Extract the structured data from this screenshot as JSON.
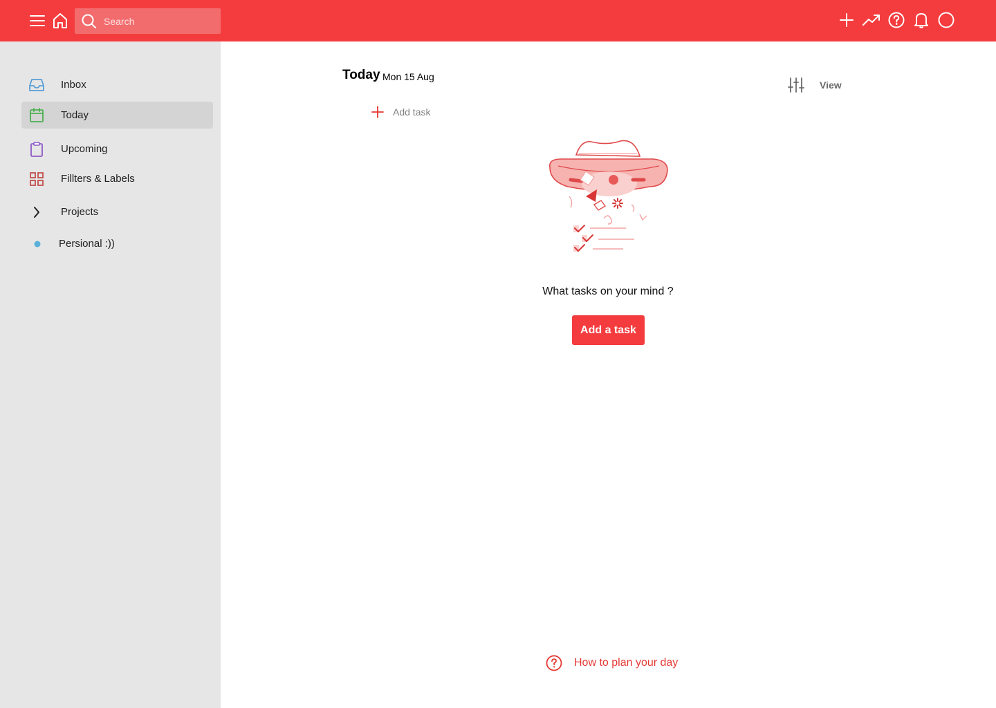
{
  "topbar": {
    "search_placeholder": "Search",
    "colors": {
      "brand": "#f43c3e"
    }
  },
  "sidebar": {
    "items": [
      {
        "label": "Inbox",
        "icon": "inbox-icon",
        "color": "#5a9ed6"
      },
      {
        "label": "Today",
        "icon": "calendar-icon",
        "color": "#4caf50",
        "active": true
      },
      {
        "label": "Upcoming",
        "icon": "clipboard-icon",
        "color": "#8e5bc6"
      },
      {
        "label": "Fillters & Labels",
        "icon": "grid-icon",
        "color": "#c0504d"
      },
      {
        "label": "Projects",
        "icon": "chevron-right-icon"
      },
      {
        "label": "Persional :))",
        "icon": "dot-icon",
        "color": "#5ab0d8"
      }
    ]
  },
  "main": {
    "title": "Today",
    "date": "Mon 15 Aug",
    "view_label": "View",
    "add_task_label": "Add task",
    "empty_state": {
      "message": "What tasks on your mind ?",
      "button_label": "Add a task"
    },
    "help_link": "How to plan your day"
  }
}
